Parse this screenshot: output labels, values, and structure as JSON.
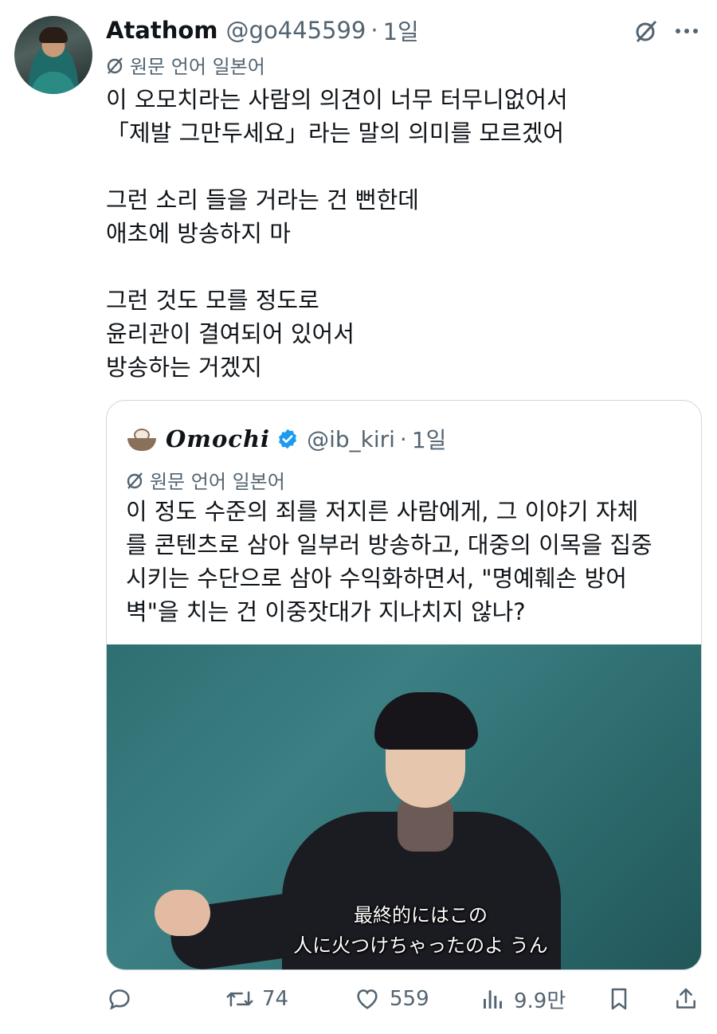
{
  "author": {
    "name": "Atathom",
    "handle": "@go445599",
    "dot": "·",
    "time": "1일"
  },
  "translation_note": "원문 언어 일본어",
  "tweet_lines": [
    "이 오모치라는 사람의 의견이 너무 터무니없어서",
    "「제발 그만두세요」라는 말의 의미를 모르겠어",
    "",
    "그런 소리 들을 거라는 건 뻔한데",
    "애초에 방송하지 마",
    "",
    "그런 것도 모를 정도로",
    "윤리관이 결여되어 있어서",
    "방송하는 거겠지"
  ],
  "quote": {
    "name": "Omochi",
    "handle": "@ib_kiri",
    "dot": "·",
    "time": "1일",
    "translation_note": "원문 언어 일본어",
    "lines": [
      "이 정도 수준의 죄를 저지른 사람에게, 그 이야기 자체",
      "를 콘텐츠로 삼아 일부러 방송하고, 대중의 이목을 집중",
      "시키는 수단으로 삼아 수익화하면서, \"명예훼손 방어",
      "벽\"을 치는 건 이중잣대가 지나치지 않나?"
    ],
    "video": {
      "subtitle_line1": "最終的にはこの",
      "subtitle_line2": "人に火つけちゃったのよ うん"
    }
  },
  "actions": {
    "retweets": "74",
    "likes": "559",
    "views": "9.9만"
  },
  "colors": {
    "text": "#0f1419",
    "secondary": "#536471",
    "verified": "#1d9bf0",
    "border": "#cfd9de"
  },
  "icons": [
    "grok-icon",
    "more-icon",
    "translate-icon",
    "verified-badge-icon",
    "reply-icon",
    "retweet-icon",
    "like-icon",
    "views-icon",
    "bookmark-icon",
    "share-icon"
  ]
}
